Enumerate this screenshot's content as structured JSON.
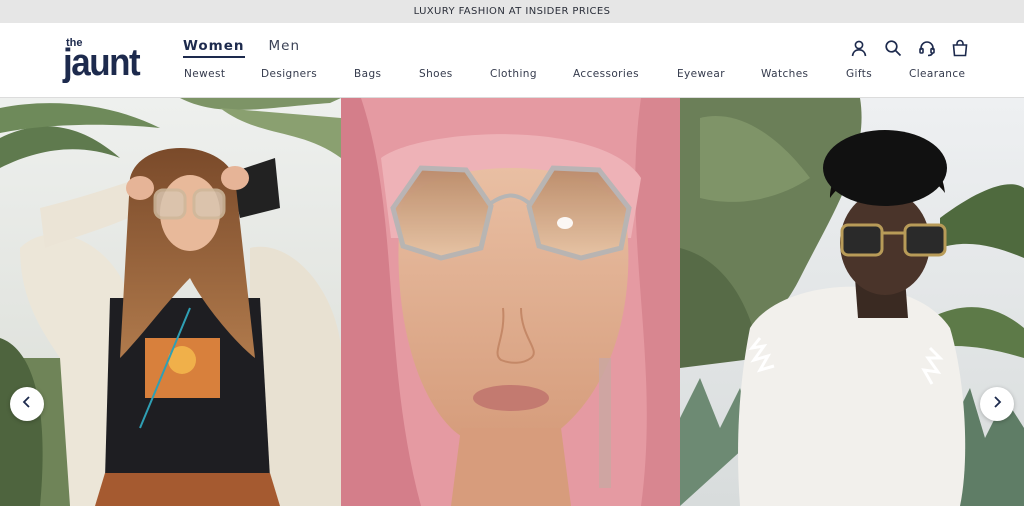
{
  "promo": {
    "text": "LUXURY FASHION AT INSIDER PRICES"
  },
  "logo": {
    "small": "the",
    "big": "jaunt"
  },
  "gender_tabs": [
    {
      "label": "Women",
      "active": true
    },
    {
      "label": "Men",
      "active": false
    }
  ],
  "nav": {
    "items": [
      "Newest",
      "Designers",
      "Bags",
      "Shoes",
      "Clothing",
      "Accessories",
      "Eyewear",
      "Watches",
      "Gifts",
      "Clearance"
    ]
  },
  "header_icons": [
    "account-icon",
    "search-icon",
    "support-headset-icon",
    "shopping-bag-icon"
  ],
  "hero": {
    "slides": [
      {
        "subject": "woman-in-oversized-sunglasses-palm-trees"
      },
      {
        "subject": "pink-haired-woman-hexagon-sunglasses"
      },
      {
        "subject": "man-in-square-sunglasses-white-feather-jacket"
      }
    ],
    "prev_icon": "chevron-left-icon",
    "next_icon": "chevron-right-icon"
  },
  "colors": {
    "brand_navy": "#1d2a4d",
    "promo_bg": "#e6e6e6",
    "text": "#343a4c"
  }
}
